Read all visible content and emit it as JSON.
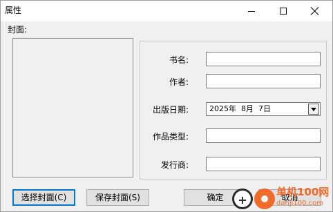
{
  "window": {
    "title": "属性",
    "controls": {
      "minimize_icon": "minimize-icon",
      "maximize_icon": "maximize-icon",
      "close_icon": "close-icon"
    }
  },
  "cover": {
    "label": "封面:"
  },
  "fields": {
    "title_label": "书名:",
    "title_value": "",
    "author_label": "作者:",
    "author_value": "",
    "pubdate_label": "出版日期:",
    "pubdate_value": "2025年  8月  7日",
    "genre_label": "作品类型:",
    "genre_value": "",
    "publisher_label": "发行商:",
    "publisher_value": ""
  },
  "buttons": {
    "select_cover": "选择封面(C)",
    "save_cover": "保存封面(S)",
    "ok": "确定",
    "cancel": "取消"
  },
  "watermark": {
    "brand": "单机100网",
    "url": "danji100.com"
  },
  "colors": {
    "focus_border": "#0078d7",
    "watermark_orange": "#f26522",
    "dialog_bg": "#f0f0f0"
  }
}
